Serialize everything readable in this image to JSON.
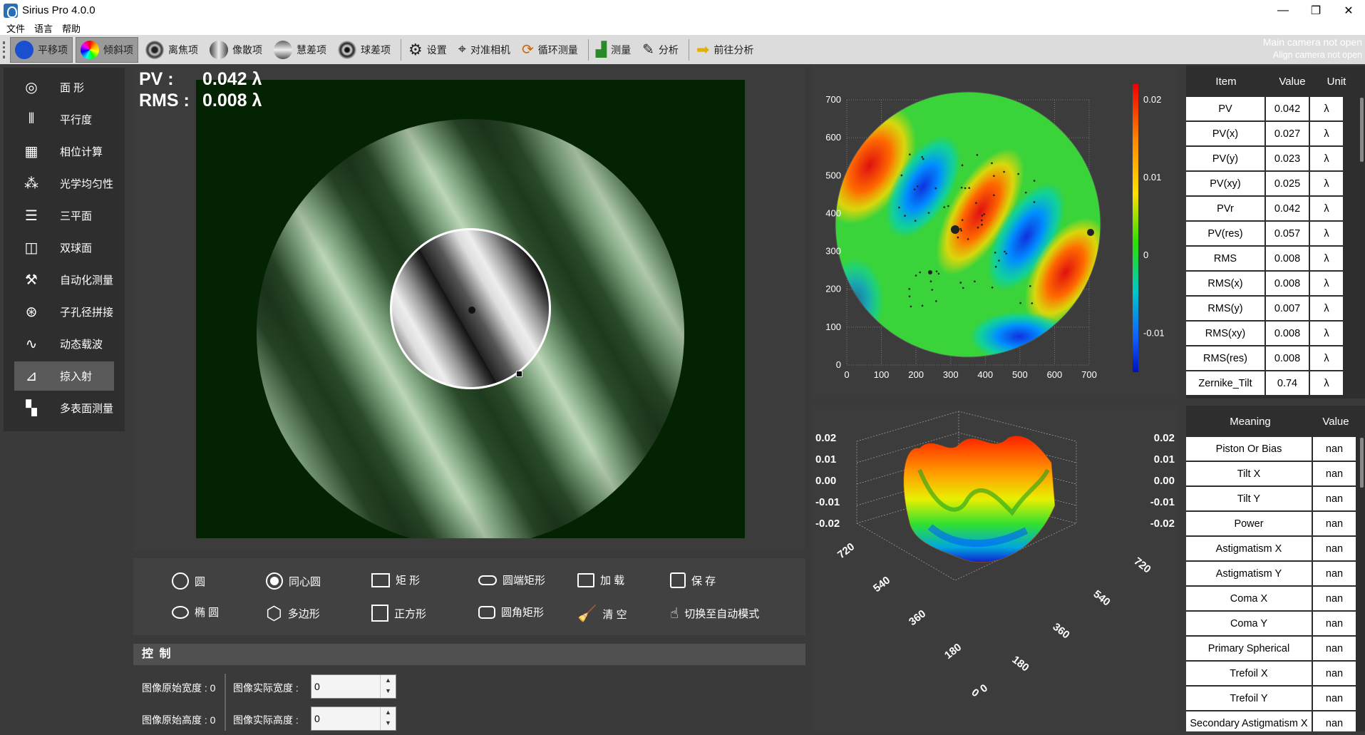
{
  "window": {
    "title": "Sirius Pro 4.0.0",
    "min": "—",
    "restore": "❐",
    "close": "✕"
  },
  "menu": [
    "文件",
    "语言",
    "帮助"
  ],
  "toolbar": {
    "items": [
      {
        "label": "平移项",
        "icon": "blue-circle-icon",
        "color": "#1a4fcf"
      },
      {
        "label": "倾斜项",
        "icon": "rainbow-circle-icon",
        "color": "rainbow"
      },
      {
        "label": "离焦项",
        "icon": "ring-icon",
        "color": "#555"
      },
      {
        "label": "像散项",
        "icon": "astig-icon",
        "color": "#888"
      },
      {
        "label": "慧差项",
        "icon": "coma-icon",
        "color": "#999"
      },
      {
        "label": "球差项",
        "icon": "sphere-icon",
        "color": "#444"
      },
      {
        "label": "设置",
        "icon": "gear-icon"
      },
      {
        "label": "对准相机",
        "icon": "crosshair-icon"
      },
      {
        "label": "循环测量",
        "icon": "cycle-icon"
      },
      {
        "label": "测量",
        "icon": "chart-icon"
      },
      {
        "label": "分析",
        "icon": "pencil-icon"
      },
      {
        "label": "前往分析",
        "icon": "arrow-right-icon"
      }
    ],
    "status1": "Main camera not open",
    "status2": "Align camera not open"
  },
  "nav": [
    {
      "label": "面 形",
      "icon": "aperture-icon"
    },
    {
      "label": "平行度",
      "icon": "parallel-icon"
    },
    {
      "label": "相位计算",
      "icon": "calculator-icon"
    },
    {
      "label": "光学均匀性",
      "icon": "molecule-icon"
    },
    {
      "label": "三平面",
      "icon": "stack-icon"
    },
    {
      "label": "双球面",
      "icon": "double-sphere-icon"
    },
    {
      "label": "自动化测量",
      "icon": "robot-arm-icon"
    },
    {
      "label": "子孔径拼接",
      "icon": "circles-icon"
    },
    {
      "label": "动态载波",
      "icon": "waveform-icon"
    },
    {
      "label": "掠入射",
      "icon": "grazing-icon"
    },
    {
      "label": "多表面测量",
      "icon": "grid-icon"
    }
  ],
  "readout": {
    "pv_label": "PV :",
    "pv_value": "0.042 λ",
    "rms_label": "RMS :",
    "rms_value": "0.008 λ"
  },
  "shapes": {
    "circle": "圆",
    "concentric": "同心圆",
    "rect": "矩 形",
    "round_end_rect": "圆端矩形",
    "load": "加 载",
    "save": "保 存",
    "ellipse": "椭 圆",
    "polygon": "多边形",
    "square": "正方形",
    "round_corner_rect": "圆角矩形",
    "clear": "清 空",
    "auto_mode": "切换至自动模式"
  },
  "control": {
    "title": "控 制",
    "orig_width": "图像原始宽度 : 0",
    "orig_height": "图像原始高度 : 0",
    "act_width": "图像实际宽度 :",
    "act_height": "图像实际高度 :",
    "act_width_val": "0",
    "act_height_val": "0"
  },
  "chart_data": [
    {
      "type": "heatmap",
      "title": "",
      "xlim": [
        0,
        700
      ],
      "ylim": [
        0,
        700
      ],
      "x_ticks": [
        "0",
        "100",
        "200",
        "300",
        "400",
        "500",
        "600",
        "700"
      ],
      "y_ticks": [
        "0",
        "100",
        "200",
        "300",
        "400",
        "500",
        "600",
        "700"
      ],
      "colorbar": {
        "ticks": [
          "0.02",
          "0.01",
          "0",
          "-0.01"
        ],
        "range": [
          -0.015,
          0.022
        ]
      }
    },
    {
      "type": "surface3d",
      "z_ticks": [
        "0.02",
        "0.01",
        "0.00",
        "-0.01",
        "-0.02"
      ],
      "xy_ticks": [
        "720",
        "540",
        "360",
        "180",
        "0"
      ]
    }
  ],
  "table1": {
    "headers": [
      "Item",
      "Value",
      "Unit"
    ],
    "rows": [
      [
        "PV",
        "0.042",
        "λ"
      ],
      [
        "PV(x)",
        "0.027",
        "λ"
      ],
      [
        "PV(y)",
        "0.023",
        "λ"
      ],
      [
        "PV(xy)",
        "0.025",
        "λ"
      ],
      [
        "PVr",
        "0.042",
        "λ"
      ],
      [
        "PV(res)",
        "0.057",
        "λ"
      ],
      [
        "RMS",
        "0.008",
        "λ"
      ],
      [
        "RMS(x)",
        "0.008",
        "λ"
      ],
      [
        "RMS(y)",
        "0.007",
        "λ"
      ],
      [
        "RMS(xy)",
        "0.008",
        "λ"
      ],
      [
        "RMS(res)",
        "0.008",
        "λ"
      ],
      [
        "Zernike_Tilt",
        "0.74",
        "λ"
      ]
    ]
  },
  "table2": {
    "headers": [
      "Meaning",
      "Value"
    ],
    "rows": [
      [
        "Piston Or Bias",
        "nan"
      ],
      [
        "Tilt X",
        "nan"
      ],
      [
        "Tilt Y",
        "nan"
      ],
      [
        "Power",
        "nan"
      ],
      [
        "Astigmatism X",
        "nan"
      ],
      [
        "Astigmatism Y",
        "nan"
      ],
      [
        "Coma X",
        "nan"
      ],
      [
        "Coma Y",
        "nan"
      ],
      [
        "Primary Spherical",
        "nan"
      ],
      [
        "Trefoil X",
        "nan"
      ],
      [
        "Trefoil Y",
        "nan"
      ],
      [
        "Secondary Astigmatism X",
        "nan"
      ]
    ]
  }
}
